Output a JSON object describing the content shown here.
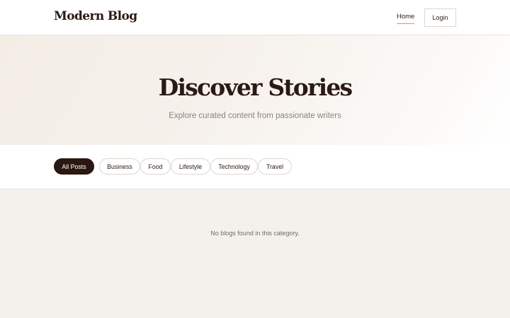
{
  "header": {
    "logo": "Modern Blog",
    "nav": {
      "home": "Home",
      "login": "Login"
    }
  },
  "hero": {
    "title": "Discover Stories",
    "subtitle": "Explore curated content from passionate writers"
  },
  "filters": {
    "items": [
      {
        "label": "All Posts",
        "active": true
      },
      {
        "label": "Business",
        "active": false
      },
      {
        "label": "Food",
        "active": false
      },
      {
        "label": "Lifestyle",
        "active": false
      },
      {
        "label": "Technology",
        "active": false
      },
      {
        "label": "Travel",
        "active": false
      }
    ]
  },
  "content": {
    "empty_message": "No blogs found in this category."
  },
  "colors": {
    "brand_dark": "#2b1711",
    "accent_underline": "#c79a6b",
    "page_background": "#f4f0eb"
  }
}
